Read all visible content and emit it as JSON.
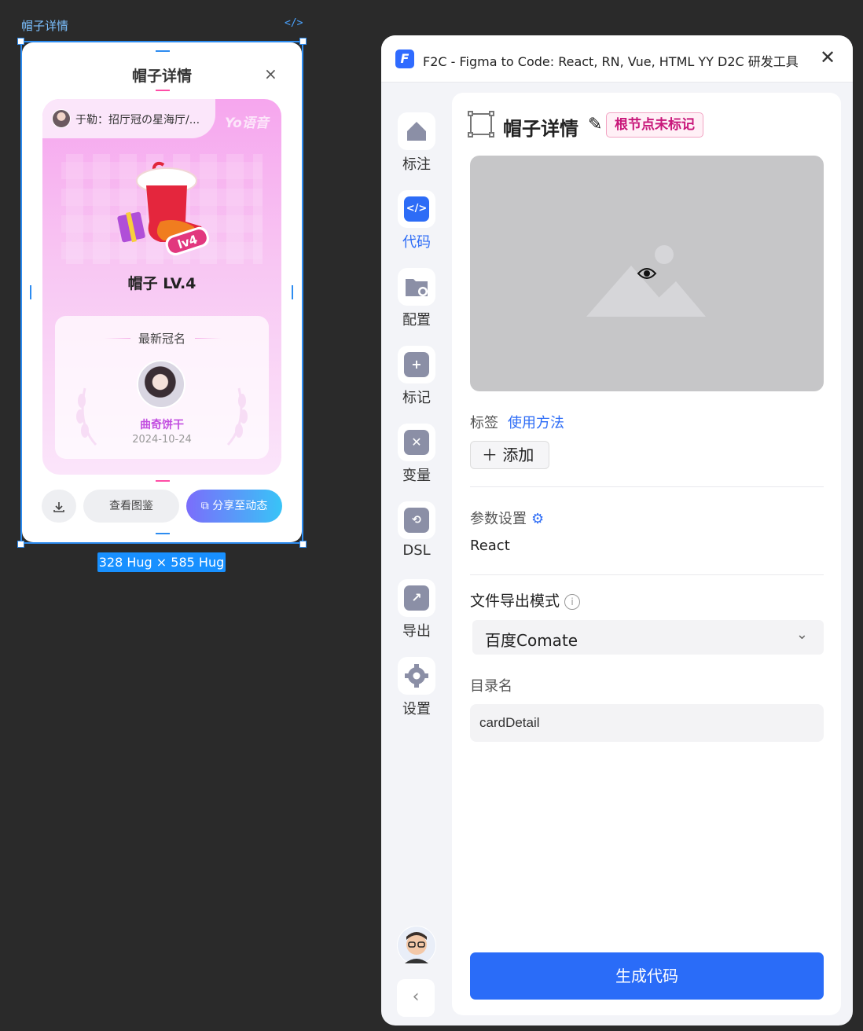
{
  "canvas": {
    "frame_label": "帽子详情",
    "frame_code_icon": "</>",
    "size_badge": "328 Hug × 585 Hug"
  },
  "card": {
    "title": "帽子详情",
    "close_icon": "×",
    "owner_text": "于勒：招厅冠の星海厅/...",
    "brand": "Yo语音",
    "hat_name": "帽子 LV.4",
    "hat_level_badge": "lv4",
    "crown_title": "最新冠名",
    "crown_user": "曲奇饼干",
    "crown_date": "2024-10-24",
    "view_button": "查看图鉴",
    "share_button": "分享至动态"
  },
  "plugin": {
    "logo_letter": "F",
    "title": "F2C - Figma to Code: React, RN, Vue, HTML YY D2C 研发工具",
    "sidebar": [
      {
        "label": "标注",
        "icon": "home-icon",
        "active": false
      },
      {
        "label": "代码",
        "icon": "code-icon",
        "active": true
      },
      {
        "label": "配置",
        "icon": "folder-settings-icon",
        "active": false
      },
      {
        "label": "标记",
        "icon": "bookmark-add-icon",
        "active": false
      },
      {
        "label": "变量",
        "icon": "variable-x-icon",
        "active": false
      },
      {
        "label": "DSL",
        "icon": "dsl-route-icon",
        "active": false
      },
      {
        "label": "导出",
        "icon": "export-icon",
        "active": false
      },
      {
        "label": "设置",
        "icon": "gear-icon",
        "active": false
      }
    ],
    "node": {
      "name": "帽子详情",
      "badge": "根节点未标记"
    },
    "tags": {
      "label": "标签",
      "help_link": "使用方法",
      "add_button": "添加"
    },
    "params": {
      "label": "参数设置",
      "value": "React"
    },
    "export_mode": {
      "label": "文件导出模式",
      "selected": "百度Comate"
    },
    "directory": {
      "label": "目录名",
      "value": "cardDetail"
    },
    "generate_button": "生成代码",
    "accent": "#2a6cf8"
  }
}
